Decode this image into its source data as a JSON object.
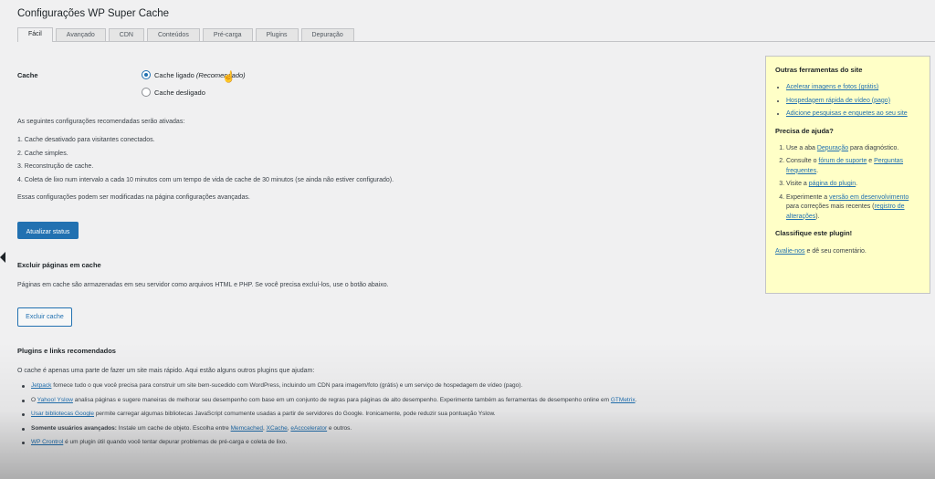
{
  "page": {
    "title": "Configurações WP Super Cache"
  },
  "tabs": [
    {
      "label": "Fácil",
      "active": true
    },
    {
      "label": "Avançado"
    },
    {
      "label": "CDN"
    },
    {
      "label": "Conteúdos"
    },
    {
      "label": "Pré-carga"
    },
    {
      "label": "Plugins"
    },
    {
      "label": "Depuração"
    }
  ],
  "cache": {
    "label": "Cache",
    "on_label": "Cache ligado",
    "on_note": "(Recomendado)",
    "off_label": "Cache desligado",
    "selected": "on"
  },
  "recommended": {
    "intro": "As seguintes configurações recomendadas serão ativadas:",
    "items": [
      "1. Cache desativado para visitantes conectados.",
      "2. Cache simples.",
      "3. Reconstrução de cache.",
      "4. Coleta de lixo num intervalo a cada 10 minutos com um tempo de vida de cache de 30 minutos (se ainda não estiver configurado)."
    ],
    "note": "Essas configurações podem ser modificadas na página configurações avançadas.",
    "update_button": "Atualizar status"
  },
  "delete_section": {
    "heading": "Excluir páginas em cache",
    "text": "Páginas em cache são armazenadas em seu servidor como arquivos HTML e PHP. Se você precisa excluí-los, use o botão abaixo.",
    "button": "Excluir cache"
  },
  "plugins_section": {
    "heading": "Plugins e links recomendados",
    "intro": "O cache é apenas uma parte de fazer um site mais rápido. Aqui estão alguns outros plugins que ajudam:",
    "items": [
      {
        "link": "Jetpack",
        "pre": "",
        "text": " fornece tudo o que você precisa para construir um site bem-sucedido com WordPress, incluindo um CDN para imagem/foto (grátis) e um serviço de hospedagem de vídeo (pago)."
      },
      {
        "pre": "O ",
        "link": "Yahoo! Yslow",
        "text": " analisa páginas e sugere maneiras de melhorar seu desempenho com base em um conjunto de regras para páginas de alto desempenho. Experimente também as ferramentas de desempenho online em ",
        "link2": "GTMetrix",
        "post": "."
      },
      {
        "pre": "",
        "link": "Usar bibliotecas Google",
        "text": " permite carregar algumas bibliotecas JavaScript comumente usadas a partir de servidores do Google. Ironicamente, pode reduzir sua pontuação Yslow."
      },
      {
        "bold": "Somente usuários avançados:",
        "text": " Instale um cache de objeto. Escolha entre ",
        "link": "Memcached",
        "sep1": ", ",
        "link2": "XCache",
        "sep2": ", ",
        "link3": "eAcccelerator",
        "post": " e outros."
      },
      {
        "pre": "",
        "link": "WP Crontrol",
        "text": " é um plugin útil quando você tentar depurar problemas de pré-carga e coleta de lixo."
      }
    ]
  },
  "sidebar": {
    "tools_heading": "Outras ferramentas do site",
    "tools": [
      "Acelerar imagens e fotos (grátis)",
      "Hospedagem rápida de vídeo (pago)",
      "Adicione pesquisas e enquetes ao seu site"
    ],
    "help_heading": "Precisa de ajuda?",
    "help": {
      "item1_pre": "Use a aba ",
      "item1_link": "Depuração",
      "item1_post": " para diagnóstico.",
      "item2_pre": "Consulte o ",
      "item2_link": "fórum de suporte",
      "item2_mid": " e ",
      "item2_link2": "Perguntas frequentes",
      "item2_post": ".",
      "item3_pre": "Visite a ",
      "item3_link": "página do plugin",
      "item3_post": ".",
      "item4_pre": "Experimente a ",
      "item4_link": "versão em desenvolvimento",
      "item4_mid": " para correções mais recentes (",
      "item4_link2": "registro de alterações",
      "item4_post": ")."
    },
    "rate_heading": "Classifique este plugin!",
    "rate_link": "Avalie-nos",
    "rate_text": " e dê seu comentário."
  },
  "colors": {
    "accent": "#2271b1",
    "sidebar_bg": "#ffffc7",
    "background": "#f0f0f1"
  }
}
